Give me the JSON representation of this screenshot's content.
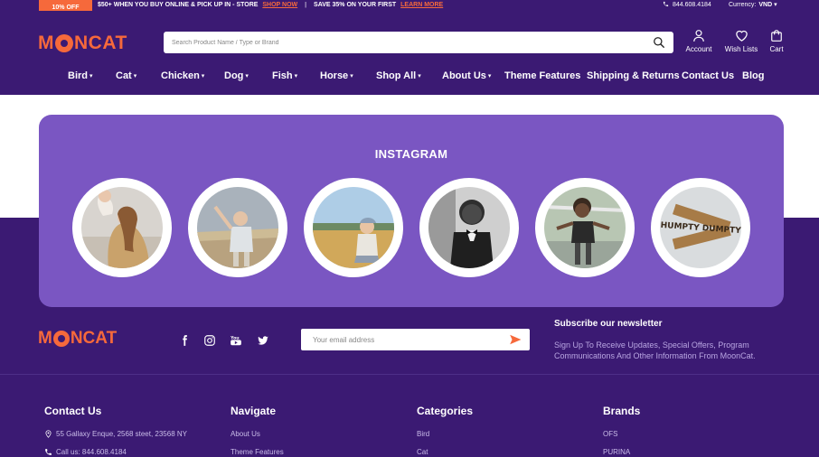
{
  "topbar": {
    "badge": "10% OFF",
    "promo1": "$50+ WHEN YOU BUY ONLINE & PICK UP IN - STORE",
    "promo1_link": "SHOP NOW",
    "separator": "|",
    "promo2": "SAVE 35% ON YOUR FIRST",
    "promo2_link": "LEARN MORE",
    "phone": "844.608.4184",
    "currency_label": "Currency:",
    "currency_value": "VND"
  },
  "header": {
    "logo_left": "M",
    "logo_right": "NCAT",
    "search_placeholder": "Search Product Name / Type or Brand",
    "account": "Account",
    "wishlists": "Wish Lists",
    "cart": "Cart"
  },
  "nav": [
    {
      "label": "Bird",
      "caret": "▾"
    },
    {
      "label": "Cat",
      "caret": "▾"
    },
    {
      "label": "Chicken",
      "caret": "▾"
    },
    {
      "label": "Dog",
      "caret": "▾"
    },
    {
      "label": "Fish",
      "caret": "▾"
    },
    {
      "label": "Horse",
      "caret": "▾"
    },
    {
      "label": "Shop All",
      "caret": "▾"
    },
    {
      "label": "About Us",
      "caret": "▾"
    },
    {
      "label": "Theme Features",
      "caret": ""
    },
    {
      "label": "Shipping & Returns",
      "caret": ""
    },
    {
      "label": "Contact Us",
      "caret": ""
    },
    {
      "label": "Blog",
      "caret": ""
    }
  ],
  "instagram": {
    "title": "INSTAGRAM",
    "scrabble_text": "HUMPTY DUMPTY"
  },
  "footer": {
    "logo_left": "M",
    "logo_right": "NCAT",
    "email_placeholder": "Your email address",
    "newsletter_title": "Subscribe our newsletter",
    "newsletter_text": "Sign Up To Receive Updates, Special Offers, Program Communications And Other Information From MoonCat.",
    "contact": {
      "title": "Contact Us",
      "address": "55 Gallaxy Enque, 2568 steet, 23568 NY",
      "phone": "Call us: 844.608.4184"
    },
    "navigate": {
      "title": "Navigate",
      "links": [
        "About Us",
        "Theme Features"
      ]
    },
    "categories": {
      "title": "Categories",
      "links": [
        "Bird",
        "Cat"
      ]
    },
    "brands": {
      "title": "Brands",
      "links": [
        "OFS",
        "PURINA"
      ]
    }
  },
  "colors": {
    "brand_purple": "#3b1a73",
    "panel_purple": "#7a56c2",
    "accent_orange": "#f6693b"
  }
}
